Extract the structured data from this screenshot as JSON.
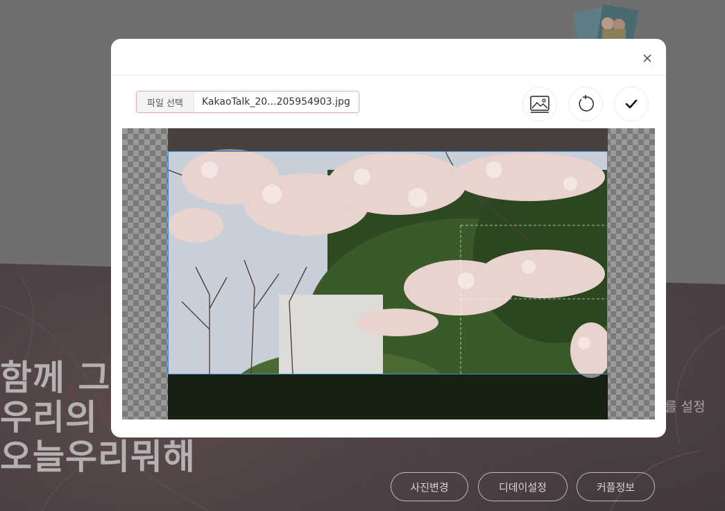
{
  "background": {
    "hero_lines": [
      "함께 그려",
      "우리의 이",
      "오늘우리뭐해"
    ],
    "side_text": "를 설정",
    "buttons": [
      "사진변경",
      "디데이설정",
      "커플정보"
    ]
  },
  "modal": {
    "close_icon": "close-icon",
    "file_input": {
      "label": "파일 선택",
      "filename": "KakaoTalk_20...205954903.jpg"
    },
    "toolbar": {
      "icons": [
        "image-icon",
        "rotate-icon",
        "check-icon"
      ]
    },
    "crop": {
      "selection": "highlighted crop region"
    }
  }
}
